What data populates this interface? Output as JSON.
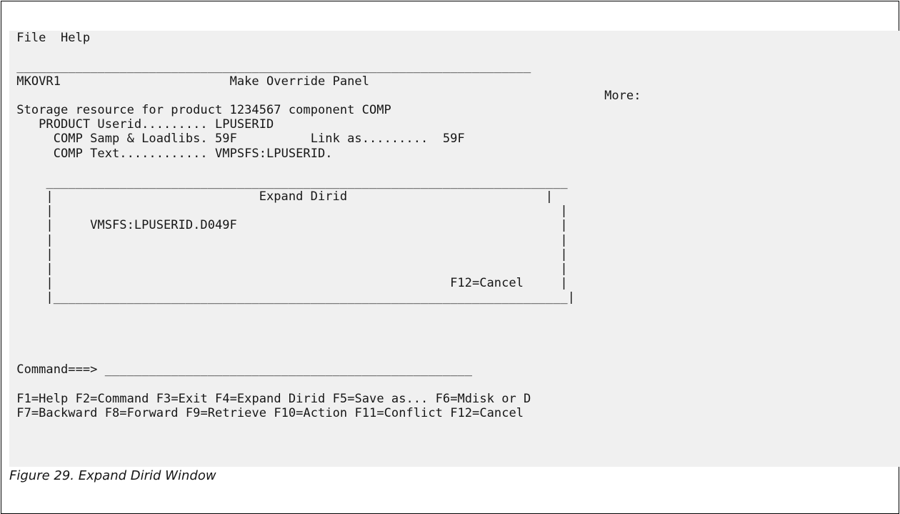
{
  "menu": {
    "file_label": "File",
    "help_label": "Help"
  },
  "panel": {
    "rule_top": "______________________________________________________________________",
    "id": "MKOVR1",
    "title": "Make Override Panel",
    "more_label": "More:",
    "storage_text": "Storage resource for product 1234567 component COMP",
    "product_userid_label": "PRODUCT Userid.........",
    "product_userid_value": "LPUSERID",
    "comp_samp_label": "COMP Samp & Loadlibs.",
    "comp_samp_value": "59F",
    "link_as_label": "Link as.........",
    "link_as_value": "59F",
    "comp_text_label": "COMP Text............",
    "comp_text_value": "VMPSFS:LPUSERID."
  },
  "popup": {
    "top_rule": "_______________________________________________________________________",
    "title": "Expand Dirid",
    "dirid_value": "VMSFS:LPUSERID.D049F",
    "cancel_key": "F12=Cancel",
    "bottom_rule": "______________________________________________________________________"
  },
  "command": {
    "label": "Command===>",
    "input_value": "__________________________________________________"
  },
  "function_keys": {
    "row1": [
      "F1=Help",
      "F2=Command",
      "F3=Exit",
      "F4=Expand Dirid",
      "F5=Save as...",
      "F6=Mdisk or D"
    ],
    "row2": [
      "F7=Backward",
      "F8=Forward",
      "F9=Retrieve",
      "F10=Action",
      "F11=Conflict",
      "F12=Cancel"
    ]
  },
  "caption": "Figure 29. Expand Dirid Window"
}
